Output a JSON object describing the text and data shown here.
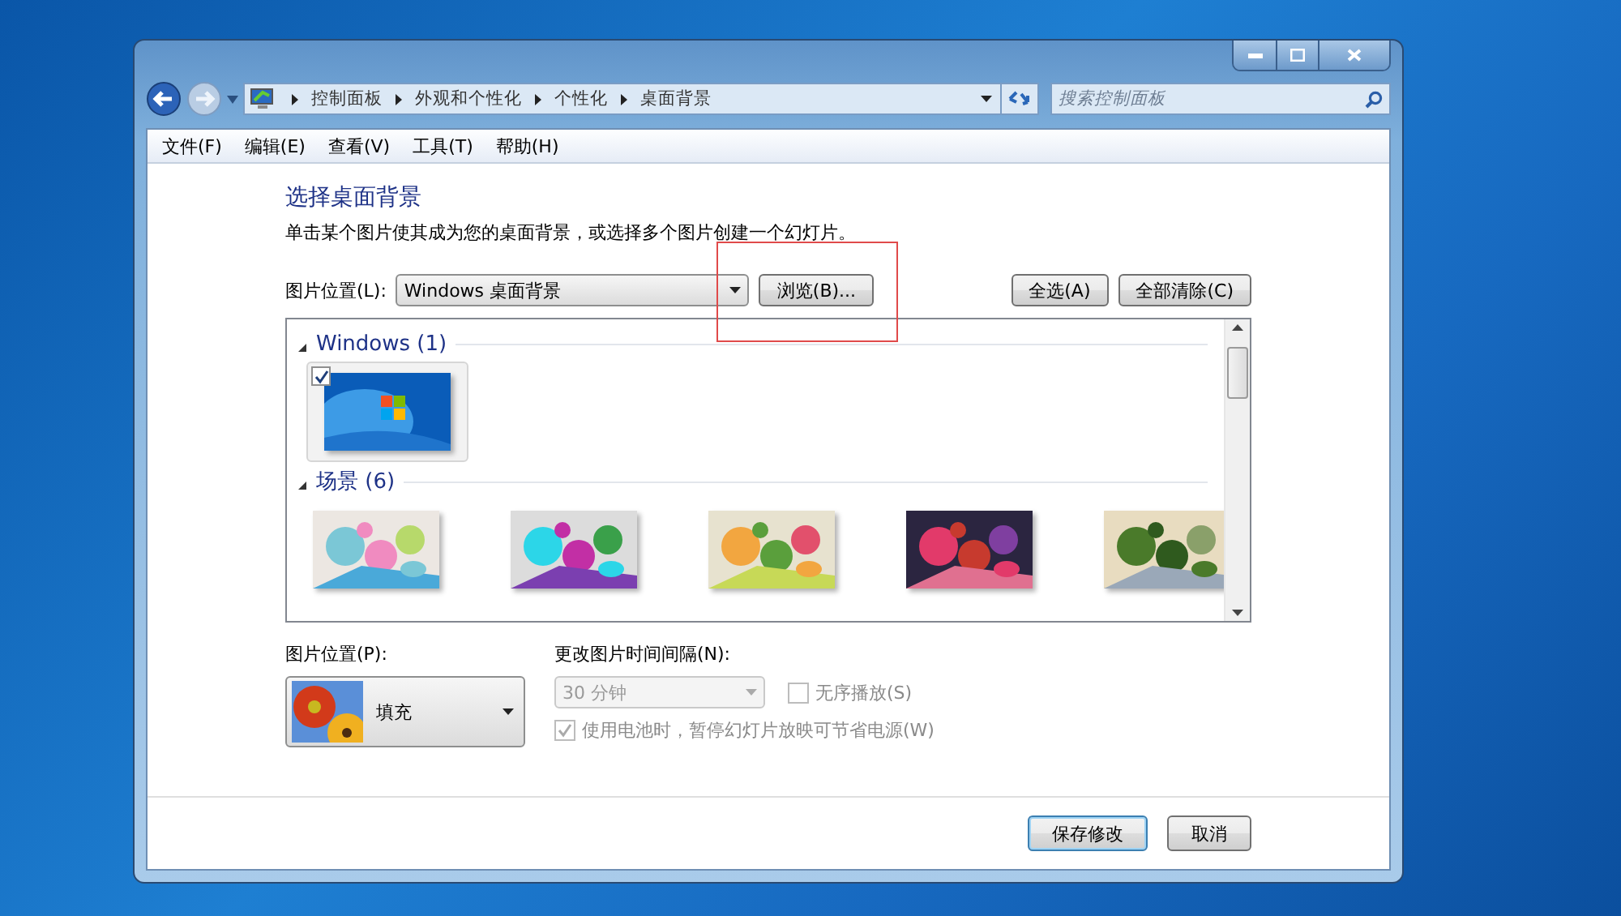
{
  "address_bar": {
    "breadcrumbs": [
      "控制面板",
      "外观和个性化",
      "个性化",
      "桌面背景"
    ]
  },
  "search": {
    "placeholder": "搜索控制面板"
  },
  "menu": [
    "文件(F)",
    "编辑(E)",
    "查看(V)",
    "工具(T)",
    "帮助(H)"
  ],
  "heading": "选择桌面背景",
  "description": "单击某个图片使其成为您的桌面背景，或选择多个图片创建一个幻灯片。",
  "location": {
    "label": "图片位置(L):",
    "value": "Windows 桌面背景",
    "browse": "浏览(B)...",
    "select_all": "全选(A)",
    "clear_all": "全部清除(C)"
  },
  "groups": [
    {
      "title": "Windows (1)",
      "expanded": true,
      "items": [
        {
          "kind": "picture",
          "checked": true,
          "selected": true
        }
      ]
    },
    {
      "title": "场景 (6)",
      "expanded": true,
      "items": [
        {
          "kind": "picture",
          "checked": false,
          "selected": false
        },
        {
          "kind": "picture",
          "checked": false,
          "selected": false
        },
        {
          "kind": "picture",
          "checked": false,
          "selected": false
        },
        {
          "kind": "picture",
          "checked": false,
          "selected": false
        },
        {
          "kind": "picture",
          "checked": false,
          "selected": false
        }
      ]
    }
  ],
  "position": {
    "label": "图片位置(P):",
    "value": "填充"
  },
  "interval": {
    "label": "更改图片时间间隔(N):",
    "value": "30 分钟",
    "disabled": true
  },
  "shuffle": {
    "label": "无序播放(S)",
    "checked": false,
    "disabled": true
  },
  "battery": {
    "label": "使用电池时，暂停幻灯片放映可节省电源(W)",
    "checked": true,
    "disabled": true
  },
  "footer_buttons": [
    {
      "label": "保存修改",
      "default": true
    },
    {
      "label": "取消",
      "default": false
    }
  ]
}
